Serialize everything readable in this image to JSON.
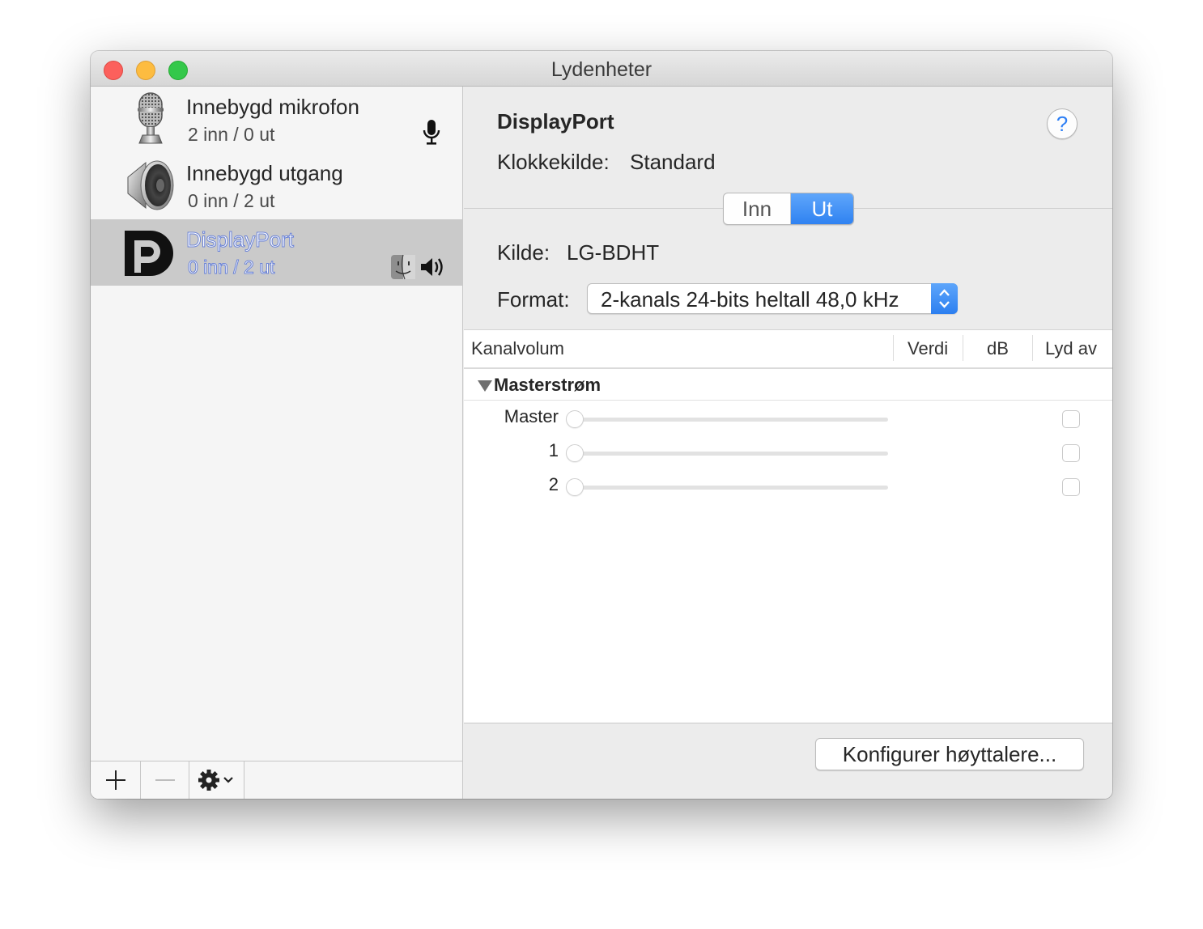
{
  "window": {
    "title": "Lydenheter"
  },
  "sidebar": {
    "devices": [
      {
        "name": "Innebygd mikrofon",
        "io": "2 inn / 0 ut",
        "icon": "microphone-icon",
        "badge": "microphone-badge-icon",
        "selected": false
      },
      {
        "name": "Innebygd utgang",
        "io": "0 inn / 2 ut",
        "icon": "speaker-icon",
        "badge": "",
        "selected": false
      },
      {
        "name": "DisplayPort",
        "io": "0 inn / 2 ut",
        "icon": "displayport-icon",
        "badge": "finder-speaker-badge-icon",
        "selected": true
      }
    ],
    "toolbar": {
      "add": "+",
      "remove": "−",
      "action": "gear-icon"
    }
  },
  "detail": {
    "device_name": "DisplayPort",
    "help": "?",
    "clock_label": "Klokkekilde:",
    "clock_value": "Standard",
    "tabs": [
      {
        "label": "Inn",
        "selected": false
      },
      {
        "label": "Ut",
        "selected": true
      }
    ],
    "source_label": "Kilde:",
    "source_value": "LG-BDHT",
    "format_label": "Format:",
    "format_value": "2-kanals 24-bits heltall 48,0 kHz",
    "table": {
      "headers": {
        "channel": "Kanalvolum",
        "value": "Verdi",
        "db": "dB",
        "mute": "Lyd av"
      },
      "group": "Masterstrøm",
      "rows": [
        {
          "label": "Master",
          "level": 0,
          "muted": false
        },
        {
          "label": "1",
          "level": 0,
          "muted": false
        },
        {
          "label": "2",
          "level": 0,
          "muted": false
        }
      ]
    },
    "configure_button": "Konfigurer høyttalere..."
  },
  "colors": {
    "accent": "#2f82f1",
    "selection": "#cacaca",
    "close": "#fc605c",
    "minimize": "#fdbc40",
    "zoom": "#34c84a"
  }
}
